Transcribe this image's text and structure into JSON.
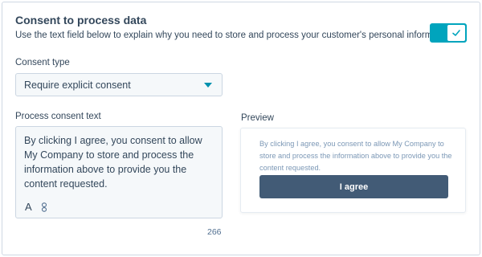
{
  "header": {
    "title": "Consent to process data",
    "subtitle": "Use the text field below to explain why you need to store and process your customer's personal information.",
    "toggle": {
      "on": true,
      "icon": "checkmark-icon"
    }
  },
  "consent_type": {
    "label": "Consent type",
    "selected": "Require explicit consent"
  },
  "process_text": {
    "label": "Process consent text",
    "value": "By clicking I agree, you consent to allow My Company to store and process the information above to provide you the content requested.",
    "toolbar": {
      "font_icon": "A",
      "link_icon": "link-icon"
    },
    "char_count": "266"
  },
  "preview": {
    "label": "Preview",
    "text": "By clicking I agree, you consent to allow My Company to store and process the information above to provide you the content requested.",
    "button_label": "I agree"
  },
  "colors": {
    "accent": "#00a4bd",
    "caret": "#0091ae",
    "button": "#425b76",
    "text": "#33475b",
    "muted": "#7c98b6"
  }
}
